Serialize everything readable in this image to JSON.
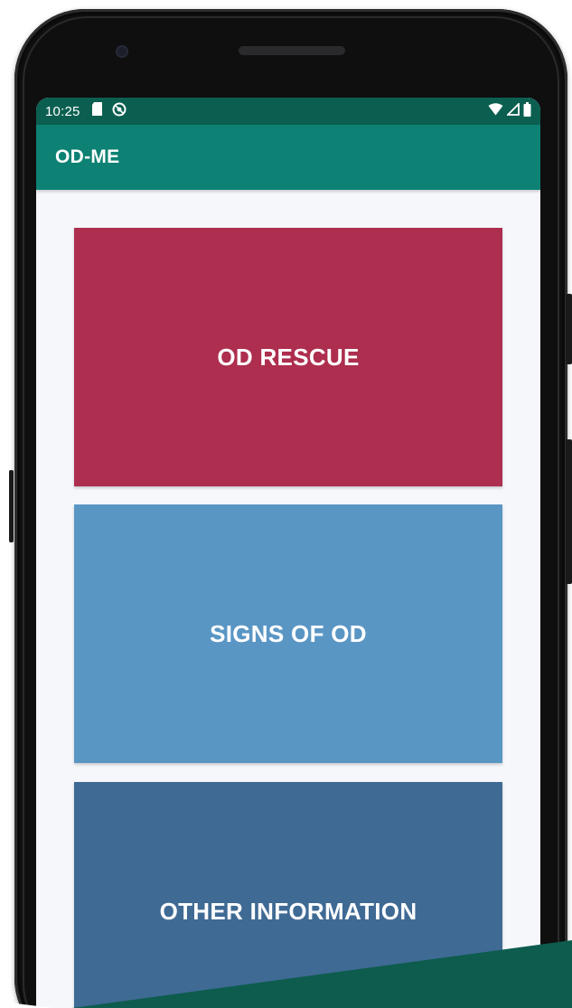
{
  "status_bar": {
    "time": "10:25",
    "left_icons": [
      "sd-card-icon",
      "sync-icon"
    ],
    "right_icons": [
      "wifi-icon",
      "signal-icon",
      "battery-icon"
    ]
  },
  "app_bar": {
    "title": "OD-ME"
  },
  "menu": {
    "items": [
      {
        "label": "OD RESCUE",
        "color": "#ad2e4e"
      },
      {
        "label": "SIGNS OF OD",
        "color": "#5a96c4"
      },
      {
        "label": "OTHER INFORMATION",
        "color": "#3f6a94"
      }
    ]
  },
  "colors": {
    "status_bar": "#0b5f50",
    "app_bar": "#0d8173",
    "screen_background": "#f5f7fb",
    "accent_overlay": "#0d5c4e"
  }
}
